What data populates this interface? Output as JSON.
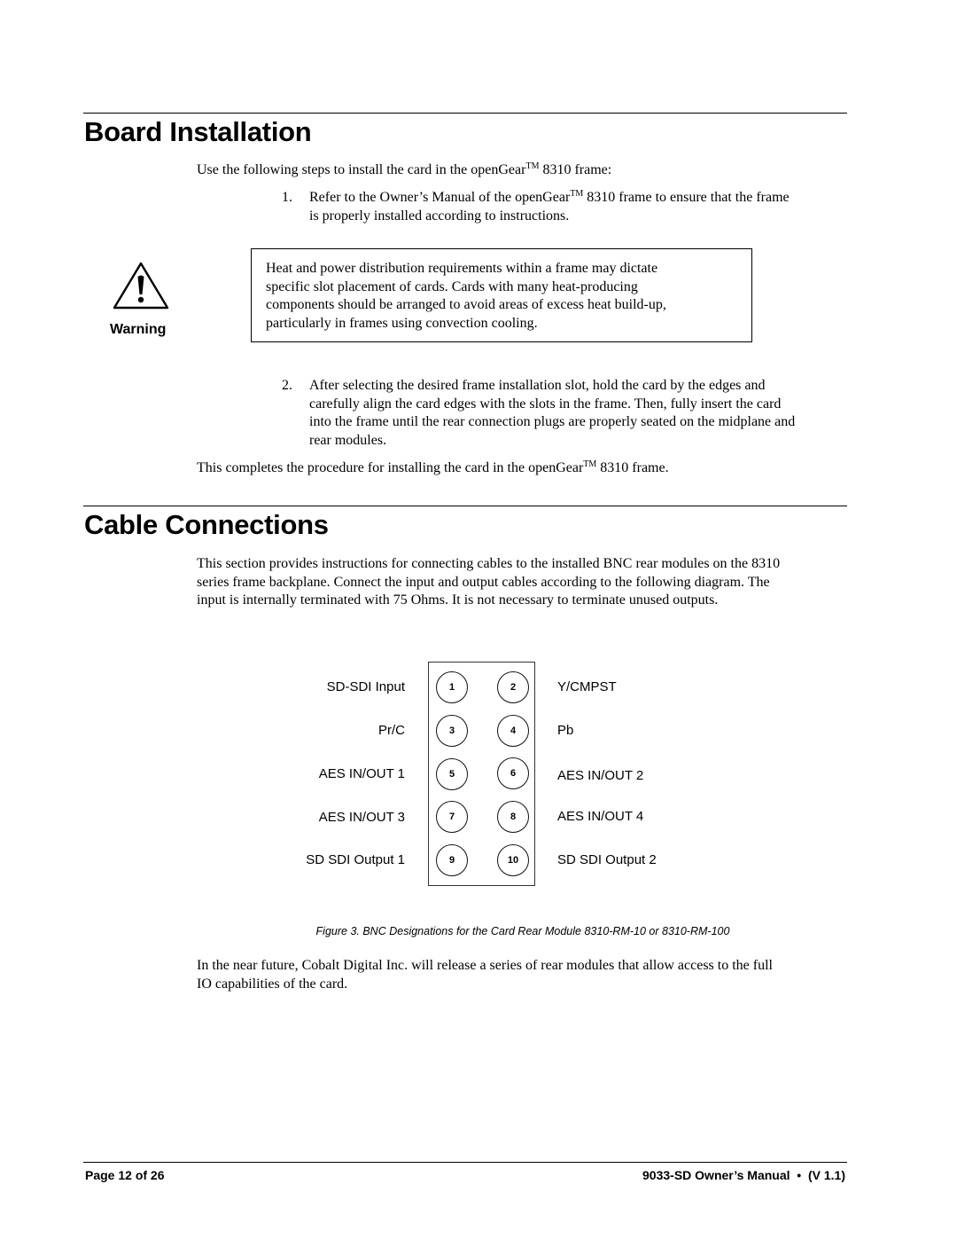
{
  "sections": {
    "board_installation": {
      "title": "Board Installation",
      "intro_pre": "Use the following steps to install the card in the openGear",
      "intro_tm": "TM",
      "intro_post": " 8310 frame:",
      "steps": [
        {
          "number": "1.",
          "line1_pre": "Refer to the Owner’s Manual of the openGear",
          "line1_tm": "TM",
          "line1_post": " 8310 frame to ensure that the frame",
          "line2": "is properly installed according to instructions."
        },
        {
          "number": "2.",
          "lines": [
            "After selecting the desired frame installation slot, hold the card by the edges and",
            "carefully align the card edges with the slots in the frame.  Then, fully insert the card",
            "into the frame until the rear connection plugs are properly seated on the midplane and",
            "rear modules."
          ]
        }
      ],
      "warning": {
        "icon": "warning-triangle-icon",
        "label": "Warning",
        "lines": [
          "Heat and power distribution requirements within a frame may dictate",
          "specific slot placement of cards.  Cards with many heat-producing",
          "components should be arranged to avoid areas of excess heat build-up,",
          "particularly in frames using convection cooling."
        ]
      },
      "closing_pre": "This completes the procedure for installing the card in the openGear",
      "closing_tm": "TM",
      "closing_post": " 8310 frame."
    },
    "cable_connections": {
      "title": "Cable Connections",
      "paragraph_lines": [
        "This section provides instructions for connecting cables to the installed BNC rear modules on the 8310",
        "series frame backplane. Connect the input and output cables according to the following diagram. The",
        "input is internally terminated with 75 Ohms.  It is not necessary to terminate unused outputs."
      ],
      "diagram": {
        "connectors": [
          {
            "number": "1",
            "label": "SD-SDI Input"
          },
          {
            "number": "2",
            "label": "Y/CMPST"
          },
          {
            "number": "3",
            "label": "Pr/C"
          },
          {
            "number": "4",
            "label": "Pb"
          },
          {
            "number": "5",
            "label": "AES IN/OUT 1"
          },
          {
            "number": "6",
            "label": "AES IN/OUT 2"
          },
          {
            "number": "7",
            "label": "AES IN/OUT 3"
          },
          {
            "number": "8",
            "label": "AES IN/OUT 4"
          },
          {
            "number": "9",
            "label": "SD SDI Output 1"
          },
          {
            "number": "10",
            "label": "SD SDI Output 2"
          }
        ],
        "caption": "Figure 3. BNC Designations for the Card Rear Module 8310-RM-10 or 8310-RM-100"
      },
      "note_lines": [
        "In the near future, Cobalt Digital Inc. will release a series of rear modules that allow access to the full",
        "IO capabilities of the card."
      ]
    }
  },
  "footer": {
    "page": "Page 12 of 26",
    "manual": "9033-SD Owner’s Manual  •  (V 1.1)"
  }
}
